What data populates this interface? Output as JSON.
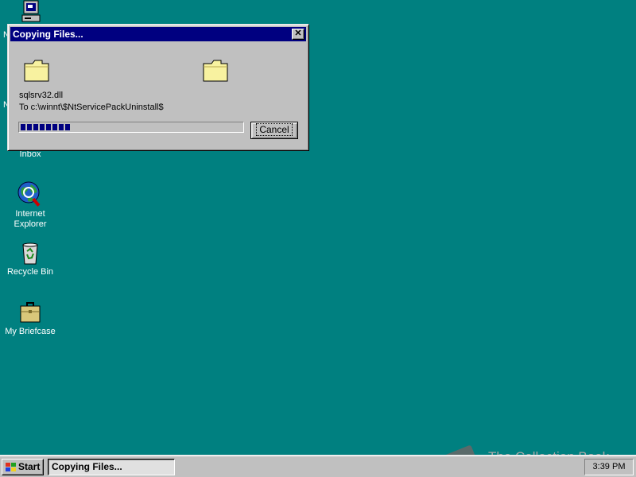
{
  "desktop": {
    "icons": [
      {
        "label": "N",
        "icon": "my-computer-icon"
      },
      {
        "label": "N",
        "icon": "network-neighborhood-icon"
      },
      {
        "label": "Inbox",
        "icon": "inbox-icon"
      },
      {
        "label": "Internet Explorer",
        "icon": "internet-explorer-icon"
      },
      {
        "label": "Recycle Bin",
        "icon": "recycle-bin-icon"
      },
      {
        "label": "My Briefcase",
        "icon": "briefcase-icon"
      }
    ],
    "ie_label_line1": "Internet",
    "ie_label_line2": "Explorer"
  },
  "dialog": {
    "title": "Copying Files...",
    "close_glyph": "✕",
    "filename": "sqlsrv32.dll",
    "destination": "To c:\\winnt\\$NtServicePackUninstall$",
    "progress_percent": 22,
    "cancel_label": "Cancel"
  },
  "taskbar": {
    "start_label": "Start",
    "task_label": "Copying Files...",
    "clock": "3:39 PM"
  },
  "watermark": {
    "text": "The Collection Book"
  },
  "colors": {
    "desktop": "#008080",
    "title_bar": "#000080",
    "progress": "#000080",
    "face": "#c0c0c0"
  }
}
